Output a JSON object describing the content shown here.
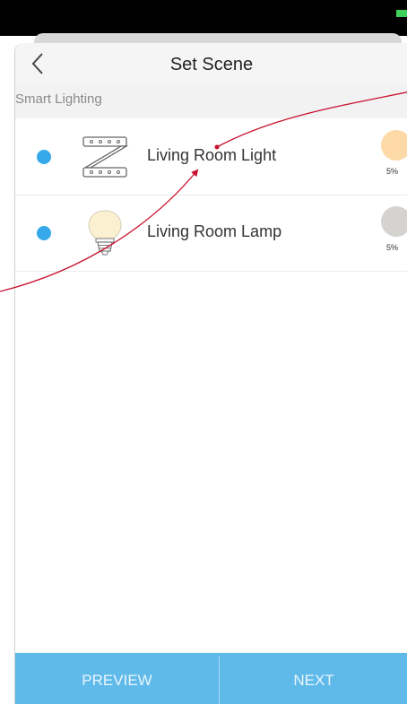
{
  "header": {
    "title": "Set Scene",
    "back_icon": "chevron-left-icon"
  },
  "section": {
    "label": "Smart Lighting"
  },
  "devices": [
    {
      "name": "Living Room Light",
      "icon": "light-strip-icon",
      "selected": true,
      "color": "#fdd9a8",
      "brightness": "5%"
    },
    {
      "name": "Living Room Lamp",
      "icon": "bulb-icon",
      "selected": true,
      "color": "#d4d3cf",
      "brightness": "5%"
    }
  ],
  "footer": {
    "preview_label": "PREVIEW",
    "next_label": "NEXT"
  },
  "colors": {
    "accent": "#5fbaea",
    "radio": "#35a9ea",
    "annotation_arrow": "#c8102e"
  }
}
